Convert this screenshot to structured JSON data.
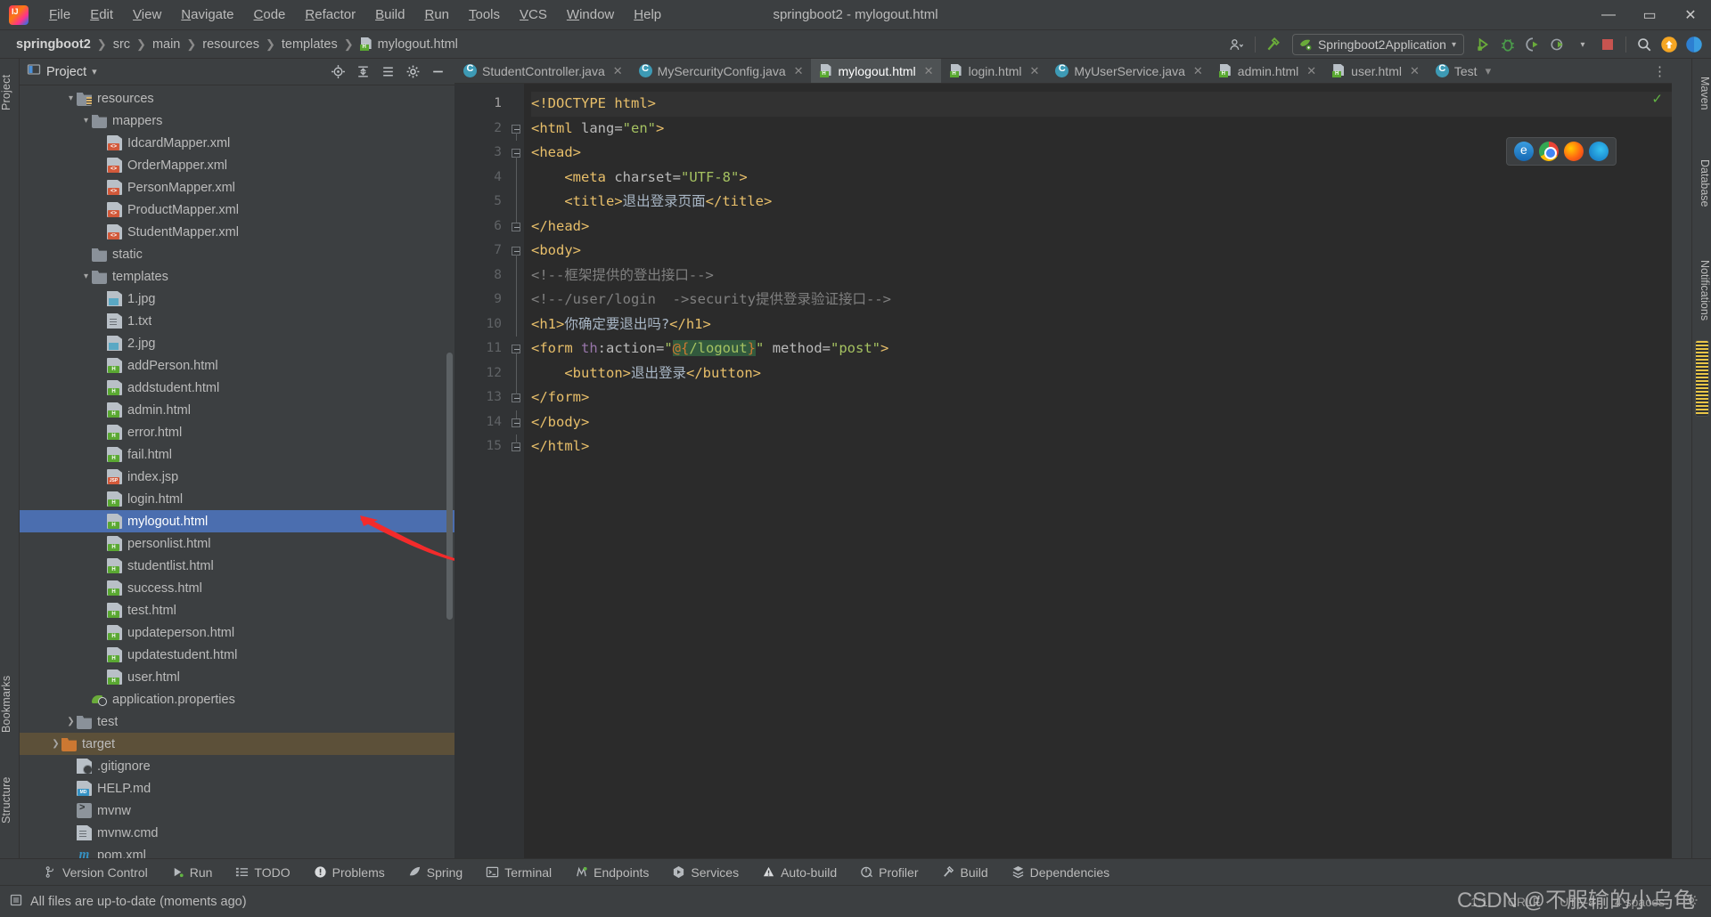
{
  "window": {
    "title": "springboot2 - mylogout.html",
    "minimize_label": "—",
    "maximize_label": "▭",
    "close_label": "✕"
  },
  "menu": [
    "File",
    "Edit",
    "View",
    "Navigate",
    "Code",
    "Refactor",
    "Build",
    "Run",
    "Tools",
    "VCS",
    "Window",
    "Help"
  ],
  "breadcrumb": [
    "springboot2",
    "src",
    "main",
    "resources",
    "templates",
    "mylogout.html"
  ],
  "toolbar": {
    "run_config": "Springboot2Application",
    "dropdown_caret": "▾",
    "icons": [
      "profile-icon",
      "build-hammer-icon",
      "run-icon",
      "debug-icon",
      "run-coverage-icon",
      "profiler-icon",
      "stop-icon",
      "search-icon",
      "updates-icon",
      "ide-icon"
    ]
  },
  "left_tool_window": {
    "tabs": [
      "Project",
      "Bookmarks",
      "Structure"
    ]
  },
  "right_tool_window": {
    "tabs": [
      "Maven",
      "Database",
      "Notifications"
    ]
  },
  "project_panel": {
    "title": "Project",
    "caret": "▾",
    "header_icons": [
      "locate-icon",
      "expand-all-icon",
      "collapse-all-icon",
      "settings-gear-icon",
      "hide-icon"
    ],
    "tree": [
      {
        "label": "resources",
        "indent": 3,
        "type": "folder-src",
        "arrow": "expanded"
      },
      {
        "label": "mappers",
        "indent": 4,
        "type": "folder",
        "arrow": "expanded"
      },
      {
        "label": "IdcardMapper.xml",
        "indent": 5,
        "type": "xml",
        "arrow": "none"
      },
      {
        "label": "OrderMapper.xml",
        "indent": 5,
        "type": "xml",
        "arrow": "none"
      },
      {
        "label": "PersonMapper.xml",
        "indent": 5,
        "type": "xml",
        "arrow": "none"
      },
      {
        "label": "ProductMapper.xml",
        "indent": 5,
        "type": "xml",
        "arrow": "none"
      },
      {
        "label": "StudentMapper.xml",
        "indent": 5,
        "type": "xml",
        "arrow": "none"
      },
      {
        "label": "static",
        "indent": 4,
        "type": "folder",
        "arrow": "none"
      },
      {
        "label": "templates",
        "indent": 4,
        "type": "folder",
        "arrow": "expanded"
      },
      {
        "label": "1.jpg",
        "indent": 5,
        "type": "image",
        "arrow": "none"
      },
      {
        "label": "1.txt",
        "indent": 5,
        "type": "text",
        "arrow": "none"
      },
      {
        "label": "2.jpg",
        "indent": 5,
        "type": "image",
        "arrow": "none"
      },
      {
        "label": "addPerson.html",
        "indent": 5,
        "type": "html",
        "arrow": "none"
      },
      {
        "label": "addstudent.html",
        "indent": 5,
        "type": "html",
        "arrow": "none"
      },
      {
        "label": "admin.html",
        "indent": 5,
        "type": "html",
        "arrow": "none"
      },
      {
        "label": "error.html",
        "indent": 5,
        "type": "html",
        "arrow": "none"
      },
      {
        "label": "fail.html",
        "indent": 5,
        "type": "html",
        "arrow": "none"
      },
      {
        "label": "index.jsp",
        "indent": 5,
        "type": "jsp",
        "arrow": "none"
      },
      {
        "label": "login.html",
        "indent": 5,
        "type": "html",
        "arrow": "none"
      },
      {
        "label": "mylogout.html",
        "indent": 5,
        "type": "html",
        "arrow": "none",
        "state": "selected"
      },
      {
        "label": "personlist.html",
        "indent": 5,
        "type": "html",
        "arrow": "none"
      },
      {
        "label": "studentlist.html",
        "indent": 5,
        "type": "html",
        "arrow": "none"
      },
      {
        "label": "success.html",
        "indent": 5,
        "type": "html",
        "arrow": "none"
      },
      {
        "label": "test.html",
        "indent": 5,
        "type": "html",
        "arrow": "none"
      },
      {
        "label": "updateperson.html",
        "indent": 5,
        "type": "html",
        "arrow": "none"
      },
      {
        "label": "updatestudent.html",
        "indent": 5,
        "type": "html",
        "arrow": "none"
      },
      {
        "label": "user.html",
        "indent": 5,
        "type": "html",
        "arrow": "none"
      },
      {
        "label": "application.properties",
        "indent": 4,
        "type": "properties",
        "arrow": "none"
      },
      {
        "label": "test",
        "indent": 3,
        "type": "folder",
        "arrow": "collapsed"
      },
      {
        "label": "target",
        "indent": 2,
        "type": "folder-orange",
        "arrow": "collapsed",
        "state": "highlight"
      },
      {
        "label": ".gitignore",
        "indent": 3,
        "type": "gitignore",
        "arrow": "none"
      },
      {
        "label": "HELP.md",
        "indent": 3,
        "type": "md",
        "arrow": "none"
      },
      {
        "label": "mvnw",
        "indent": 3,
        "type": "shell",
        "arrow": "none"
      },
      {
        "label": "mvnw.cmd",
        "indent": 3,
        "type": "text",
        "arrow": "none"
      },
      {
        "label": "pom.xml",
        "indent": 3,
        "type": "maven",
        "arrow": "none"
      }
    ]
  },
  "editor": {
    "tabs": [
      {
        "label": "StudentController.java",
        "icon": "java-class-icon",
        "active": false,
        "closable": true
      },
      {
        "label": "MySercurityConfig.java",
        "icon": "java-class-icon",
        "active": false,
        "closable": true
      },
      {
        "label": "mylogout.html",
        "icon": "html-file-icon",
        "active": true,
        "closable": true
      },
      {
        "label": "login.html",
        "icon": "html-file-icon",
        "active": false,
        "closable": true
      },
      {
        "label": "MyUserService.java",
        "icon": "java-class-icon",
        "active": false,
        "closable": true
      },
      {
        "label": "admin.html",
        "icon": "html-file-icon",
        "active": false,
        "closable": true
      },
      {
        "label": "user.html",
        "icon": "html-file-icon",
        "active": false,
        "closable": true
      },
      {
        "label": "Test",
        "icon": "java-class-icon",
        "active": false,
        "closable": false
      }
    ],
    "tab_overflow_caret": "▾",
    "tab_options": "⋮",
    "inspection_ok": "✓",
    "browser_icons": [
      "ie-browser-icon",
      "chrome-browser-icon",
      "firefox-browser-icon",
      "edge-browser-icon"
    ],
    "line_numbers": [
      "1",
      "2",
      "3",
      "4",
      "5",
      "6",
      "7",
      "8",
      "9",
      "10",
      "11",
      "12",
      "13",
      "14",
      "15"
    ],
    "lines": [
      {
        "n": 1,
        "fold": "none",
        "cur": true,
        "tokens": [
          {
            "t": "tg",
            "v": "<!DOCTYPE html>"
          }
        ]
      },
      {
        "n": 2,
        "fold": "minus",
        "tokens": [
          {
            "t": "tg",
            "v": "<html "
          },
          {
            "t": "at",
            "v": "lang="
          },
          {
            "t": "atv",
            "v": "\"en\""
          },
          {
            "t": "tg",
            "v": ">"
          }
        ]
      },
      {
        "n": 3,
        "fold": "minus",
        "tokens": [
          {
            "t": "tg",
            "v": "<head>"
          }
        ]
      },
      {
        "n": 4,
        "fold": "line",
        "tokens": [
          {
            "t": "txt",
            "v": "    "
          },
          {
            "t": "tg",
            "v": "<meta "
          },
          {
            "t": "at",
            "v": "charset="
          },
          {
            "t": "atv",
            "v": "\"UTF-8\""
          },
          {
            "t": "tg",
            "v": ">"
          }
        ]
      },
      {
        "n": 5,
        "fold": "line",
        "tokens": [
          {
            "t": "txt",
            "v": "    "
          },
          {
            "t": "tg",
            "v": "<title>"
          },
          {
            "t": "txt",
            "v": "退出登录页面"
          },
          {
            "t": "tg",
            "v": "</title>"
          }
        ]
      },
      {
        "n": 6,
        "fold": "end",
        "tokens": [
          {
            "t": "tg",
            "v": "</head>"
          }
        ]
      },
      {
        "n": 7,
        "fold": "minus",
        "tokens": [
          {
            "t": "tg",
            "v": "<body>"
          }
        ]
      },
      {
        "n": 8,
        "fold": "line",
        "tokens": [
          {
            "t": "cm",
            "v": "<!--框架提供的登出接口-->"
          }
        ]
      },
      {
        "n": 9,
        "fold": "line",
        "tokens": [
          {
            "t": "cm",
            "v": "<!--/user/login  ->security提供登录验证接口-->"
          }
        ]
      },
      {
        "n": 10,
        "fold": "line",
        "tokens": [
          {
            "t": "tg",
            "v": "<h1>"
          },
          {
            "t": "txt",
            "v": "你确定要退出吗?"
          },
          {
            "t": "tg",
            "v": "</h1>"
          }
        ]
      },
      {
        "n": 11,
        "fold": "minus",
        "tokens": [
          {
            "t": "tg",
            "v": "<form "
          },
          {
            "t": "ns",
            "v": "th"
          },
          {
            "t": "at",
            "v": ":action="
          },
          {
            "t": "atv",
            "v": "\""
          },
          {
            "t": "hl-el",
            "v": "@{"
          },
          {
            "t": "hl-el2",
            "v": "/logout"
          },
          {
            "t": "hl-el",
            "v": "}"
          },
          {
            "t": "atv",
            "v": "\""
          },
          {
            "t": "at",
            "v": " method="
          },
          {
            "t": "atv",
            "v": "\"post\""
          },
          {
            "t": "tg",
            "v": ">"
          }
        ]
      },
      {
        "n": 12,
        "fold": "line",
        "tokens": [
          {
            "t": "txt",
            "v": "    "
          },
          {
            "t": "tg",
            "v": "<button>"
          },
          {
            "t": "txt",
            "v": "退出登录"
          },
          {
            "t": "tg",
            "v": "</button>"
          }
        ]
      },
      {
        "n": 13,
        "fold": "end",
        "tokens": [
          {
            "t": "tg",
            "v": "</form>"
          }
        ]
      },
      {
        "n": 14,
        "fold": "end",
        "tokens": [
          {
            "t": "tg",
            "v": "</body>"
          }
        ]
      },
      {
        "n": 15,
        "fold": "end",
        "tokens": [
          {
            "t": "tg",
            "v": "</html>"
          }
        ]
      }
    ]
  },
  "bottom_bar": {
    "items": [
      {
        "label": "Version Control",
        "icon": "branch-icon"
      },
      {
        "label": "Run",
        "icon": "run-icon"
      },
      {
        "label": "TODO",
        "icon": "todo-list-icon"
      },
      {
        "label": "Problems",
        "icon": "problems-icon"
      },
      {
        "label": "Spring",
        "icon": "spring-leaf-icon"
      },
      {
        "label": "Terminal",
        "icon": "terminal-icon"
      },
      {
        "label": "Endpoints",
        "icon": "endpoints-icon"
      },
      {
        "label": "Services",
        "icon": "services-icon"
      },
      {
        "label": "Auto-build",
        "icon": "warning-triangle-icon"
      },
      {
        "label": "Profiler",
        "icon": "profiler-icon"
      },
      {
        "label": "Build",
        "icon": "hammer-icon"
      },
      {
        "label": "Dependencies",
        "icon": "dependencies-icon"
      }
    ]
  },
  "status_bar": {
    "message": "All files are up-to-date (moments ago)",
    "message_icon": "document-sync-icon",
    "caret_position": "1:1",
    "line_separator": "CRLF",
    "encoding": "UTF-8",
    "indent": "4 spaces",
    "gear_icon": "gear-icon"
  },
  "watermark": "CSDN @不服输的小乌龟",
  "colors": {
    "accent_selection": "#4b6eaf",
    "editor_bg": "#2b2b2b",
    "panel_bg": "#3c3f41",
    "tag": "#e8bf6a",
    "string": "#a5c261",
    "comment": "#808080",
    "namespace": "#9876aa",
    "arrow_annotation": "#f32b2b"
  }
}
